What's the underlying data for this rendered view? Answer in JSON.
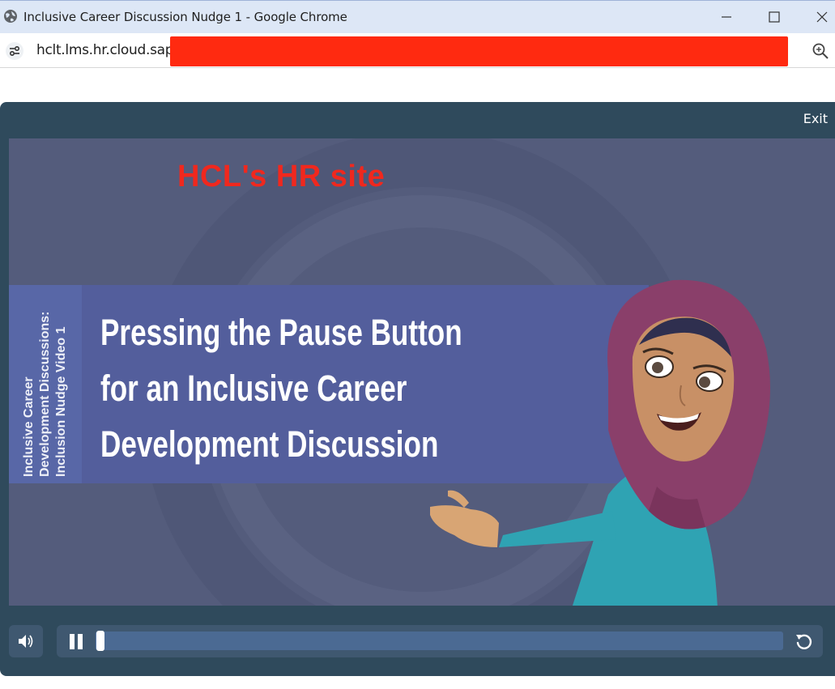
{
  "window": {
    "title": "Inclusive Career Discussion Nudge 1 - Google Chrome",
    "controls": [
      "minimize",
      "maximize",
      "close"
    ]
  },
  "address_bar": {
    "url": "hclt.lms.hr.cloud.sap/",
    "redacted": true
  },
  "player": {
    "exit_label": "Exit",
    "slide": {
      "overlay_text": "HCL's HR site",
      "side_tab": [
        "Inclusive Career",
        "Development Discussions:",
        "Inclusion Nudge Video 1"
      ],
      "headline": [
        "Pressing the Pause Button",
        "for an Inclusive Career",
        "Development  Discussion"
      ]
    },
    "controls": {
      "state": "playing",
      "progress_fraction": 0.01
    }
  },
  "colors": {
    "accent_overlay": "#f0281e",
    "player_frame": "#2f4a5c",
    "banner": "#535e9c",
    "stage": "#545c7c"
  }
}
